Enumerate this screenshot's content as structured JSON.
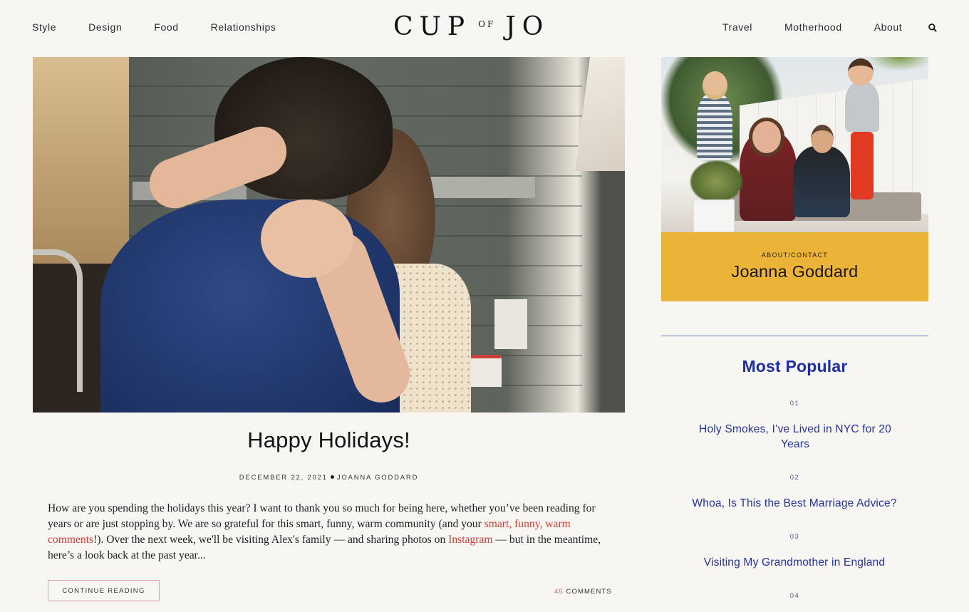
{
  "header": {
    "nav_left": [
      "Style",
      "Design",
      "Food",
      "Relationships"
    ],
    "logo": {
      "part1": "CUP",
      "part2": "OF",
      "part3": "JO"
    },
    "nav_right": [
      "Travel",
      "Motherhood",
      "About"
    ],
    "search_icon": "search-icon"
  },
  "post": {
    "image_alt": "Couple embracing in a kitchen",
    "title": "Happy Holidays!",
    "date": "DECEMBER 22, 2021",
    "author": "JOANNA GODDARD",
    "excerpt": {
      "part1": "How are you spending the holidays this year? I want to thank you so much for being here, whether you’ve been reading for years or are just stopping by. We are so grateful for this smart, funny, warm community (and your ",
      "link1": "smart, funny, warm comments",
      "part2": "!). Over the next week, we'll be visiting Alex's family — and sharing photos on ",
      "link2": "Instagram",
      "part3": " — but in the meantime, here’s a look back at the past year..."
    },
    "continue_label": "CONTINUE READING",
    "comments_count": "45",
    "comments_label": "COMMENTS"
  },
  "sidebar": {
    "about_image_alt": "Family sitting on outdoor couch",
    "about_kicker": "ABOUT/CONTACT",
    "about_name": "Joanna Goddard",
    "popular_heading": "Most Popular",
    "popular": [
      {
        "num": "01",
        "title": "Holy Smokes, I’ve Lived in NYC for 20 Years"
      },
      {
        "num": "02",
        "title": "Whoa, Is This the Best Marriage Advice?"
      },
      {
        "num": "03",
        "title": "Visiting My Grandmother in England"
      },
      {
        "num": "04",
        "title": ""
      }
    ]
  },
  "colors": {
    "background": "#f8f6f2",
    "accent_yellow": "#ebb337",
    "link_red": "#d23a33",
    "popular_blue": "#1f2fa0",
    "button_border": "#dba0a3"
  }
}
